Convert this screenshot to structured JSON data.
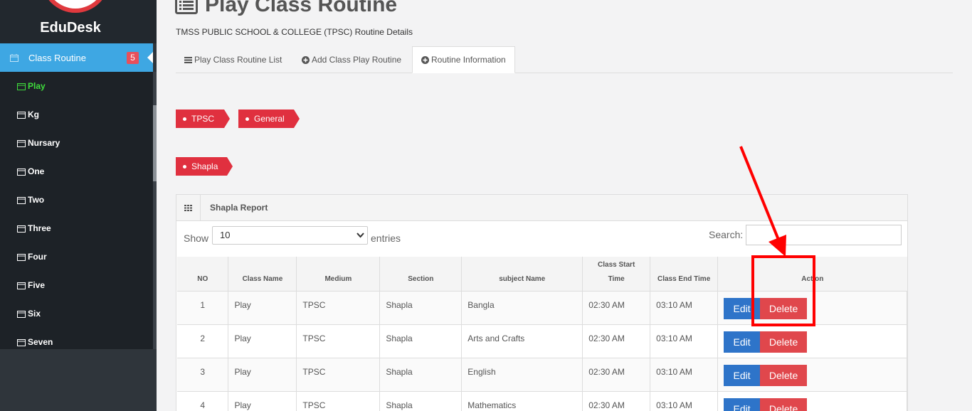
{
  "sidebar": {
    "brand": "EduDesk",
    "active_item": {
      "label": "Class Routine",
      "badge": "5"
    },
    "subitems": [
      "Play",
      "Kg",
      "Nursary",
      "One",
      "Two",
      "Three",
      "Four",
      "Five",
      "Six",
      "Seven"
    ]
  },
  "header": {
    "title": "Play Class Routine",
    "subtitle": "TMSS PUBLIC SCHOOL & COLLEGE (TPSC) Routine Details"
  },
  "tabs": [
    {
      "label": "Play Class Routine List",
      "icon": "list-icon"
    },
    {
      "label": "Add Class Play Routine",
      "icon": "plus-circle-icon"
    },
    {
      "label": "Routine Information",
      "icon": "plus-circle-icon"
    }
  ],
  "tags": {
    "medium": "TPSC",
    "group": "General",
    "section": "Shapla"
  },
  "report": {
    "title": "Shapla Report",
    "show_label": "Show",
    "entries_value": "10",
    "entries_label": "entries",
    "search_label": "Search:",
    "search_value": ""
  },
  "table": {
    "headers": {
      "no": "NO",
      "class_name": "Class Name",
      "medium": "Medium",
      "section": "Section",
      "subject": "subject Name",
      "start_line1": "Class Start",
      "start_line2": "Time",
      "end": "Class End Time",
      "action": "Action"
    },
    "rows": [
      {
        "no": "1",
        "class_name": "Play",
        "medium": "TPSC",
        "section": "Shapla",
        "subject": "Bangla",
        "start": "02:30 AM",
        "end": "03:10 AM"
      },
      {
        "no": "2",
        "class_name": "Play",
        "medium": "TPSC",
        "section": "Shapla",
        "subject": "Arts and Crafts",
        "start": "02:30 AM",
        "end": "03:10 AM"
      },
      {
        "no": "3",
        "class_name": "Play",
        "medium": "TPSC",
        "section": "Shapla",
        "subject": "English",
        "start": "02:30 AM",
        "end": "03:10 AM"
      },
      {
        "no": "4",
        "class_name": "Play",
        "medium": "TPSC",
        "section": "Shapla",
        "subject": "Mathematics",
        "start": "02:30 AM",
        "end": "03:10 AM"
      }
    ],
    "edit_label": "Edit",
    "delete_label": "Delete"
  },
  "colors": {
    "sidebar_bg": "#2f353b",
    "active_nav": "#3ea7e3",
    "tag": "#e0303f",
    "edit": "#2e74c9",
    "delete": "#e0474c",
    "annotation": "#ff0000"
  }
}
